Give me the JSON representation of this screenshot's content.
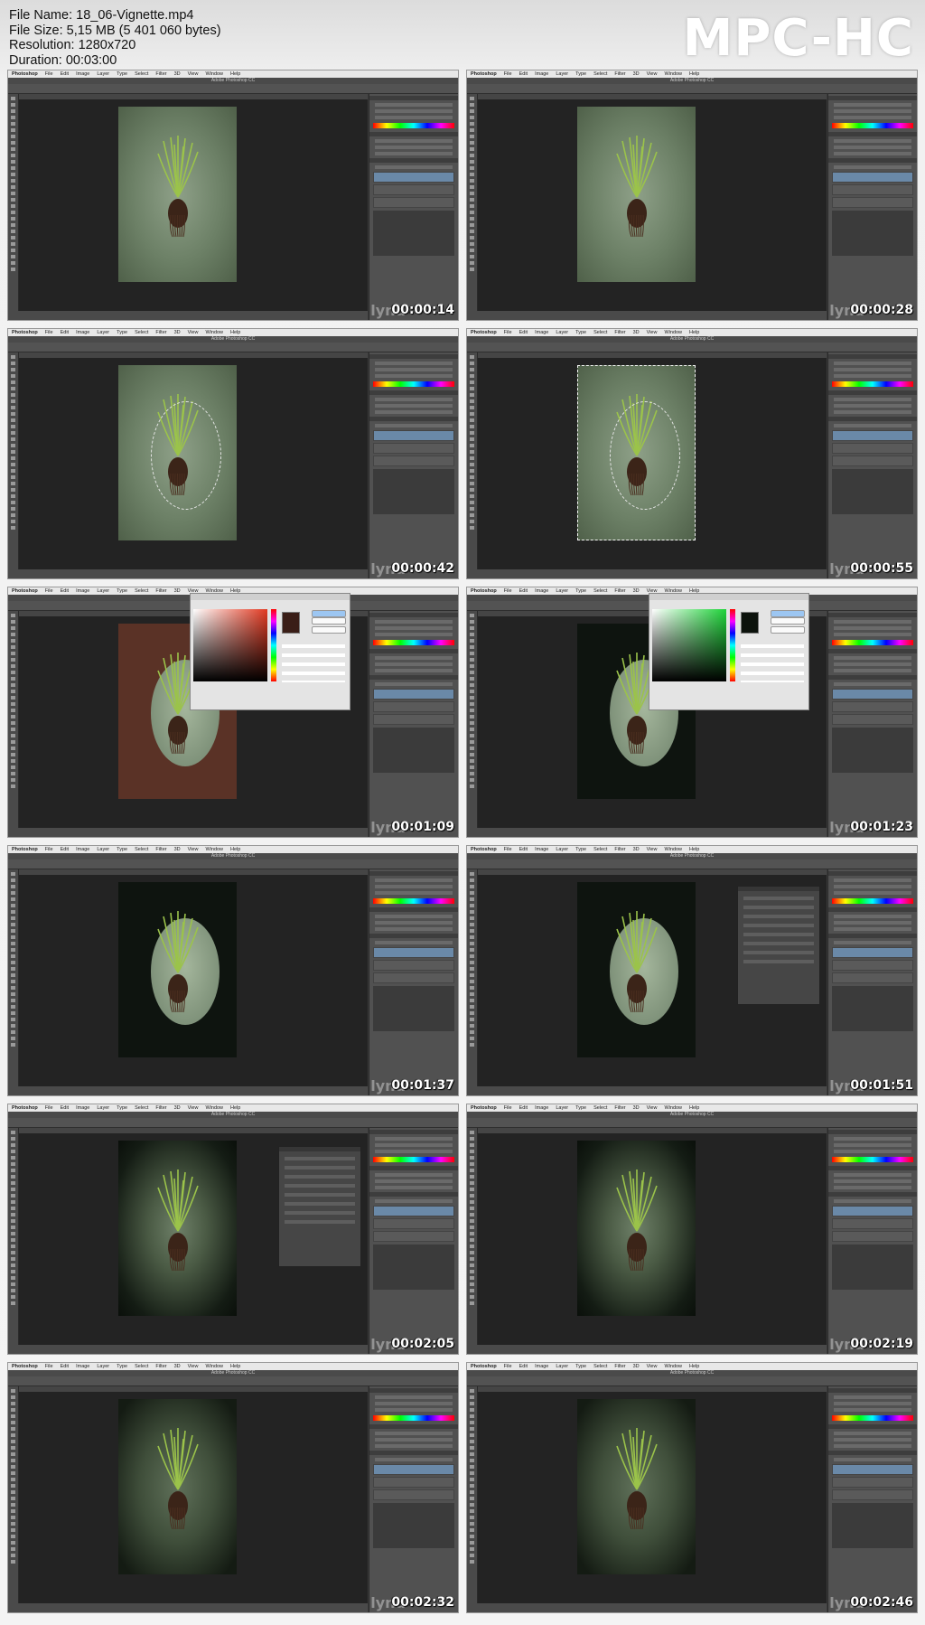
{
  "file_info": {
    "name": "File Name: 18_06-Vignette.mp4",
    "size": "File Size: 5,15 MB (5 401 060 bytes)",
    "resolution": "Resolution: 1280x720",
    "duration": "Duration: 00:03:00"
  },
  "logo": "MPC-HC",
  "app": {
    "menu": [
      "Photoshop",
      "File",
      "Edit",
      "Image",
      "Layer",
      "Type",
      "Select",
      "Filter",
      "3D",
      "View",
      "Window",
      "Help"
    ],
    "title": "Adobe Photoshop CC"
  },
  "watermark": "lynd",
  "thumbnails": [
    {
      "time": "00:00:14",
      "state": "plain"
    },
    {
      "time": "00:00:28",
      "state": "plain"
    },
    {
      "time": "00:00:42",
      "state": "ellipse-selection"
    },
    {
      "time": "00:00:55",
      "state": "inverse-selection"
    },
    {
      "time": "00:01:09",
      "state": "color-picker-red"
    },
    {
      "time": "00:01:23",
      "state": "color-picker-green"
    },
    {
      "time": "00:01:37",
      "state": "oval-dark"
    },
    {
      "time": "00:01:51",
      "state": "oval-properties"
    },
    {
      "time": "00:02:05",
      "state": "feather-properties"
    },
    {
      "time": "00:02:19",
      "state": "vignette"
    },
    {
      "time": "00:02:32",
      "state": "vignette-soft"
    },
    {
      "time": "00:02:46",
      "state": "vignette-soft"
    }
  ],
  "colors": {
    "canvas_bg": "#232323",
    "ui_panel": "#515151",
    "photo_green": "#6c8066"
  }
}
